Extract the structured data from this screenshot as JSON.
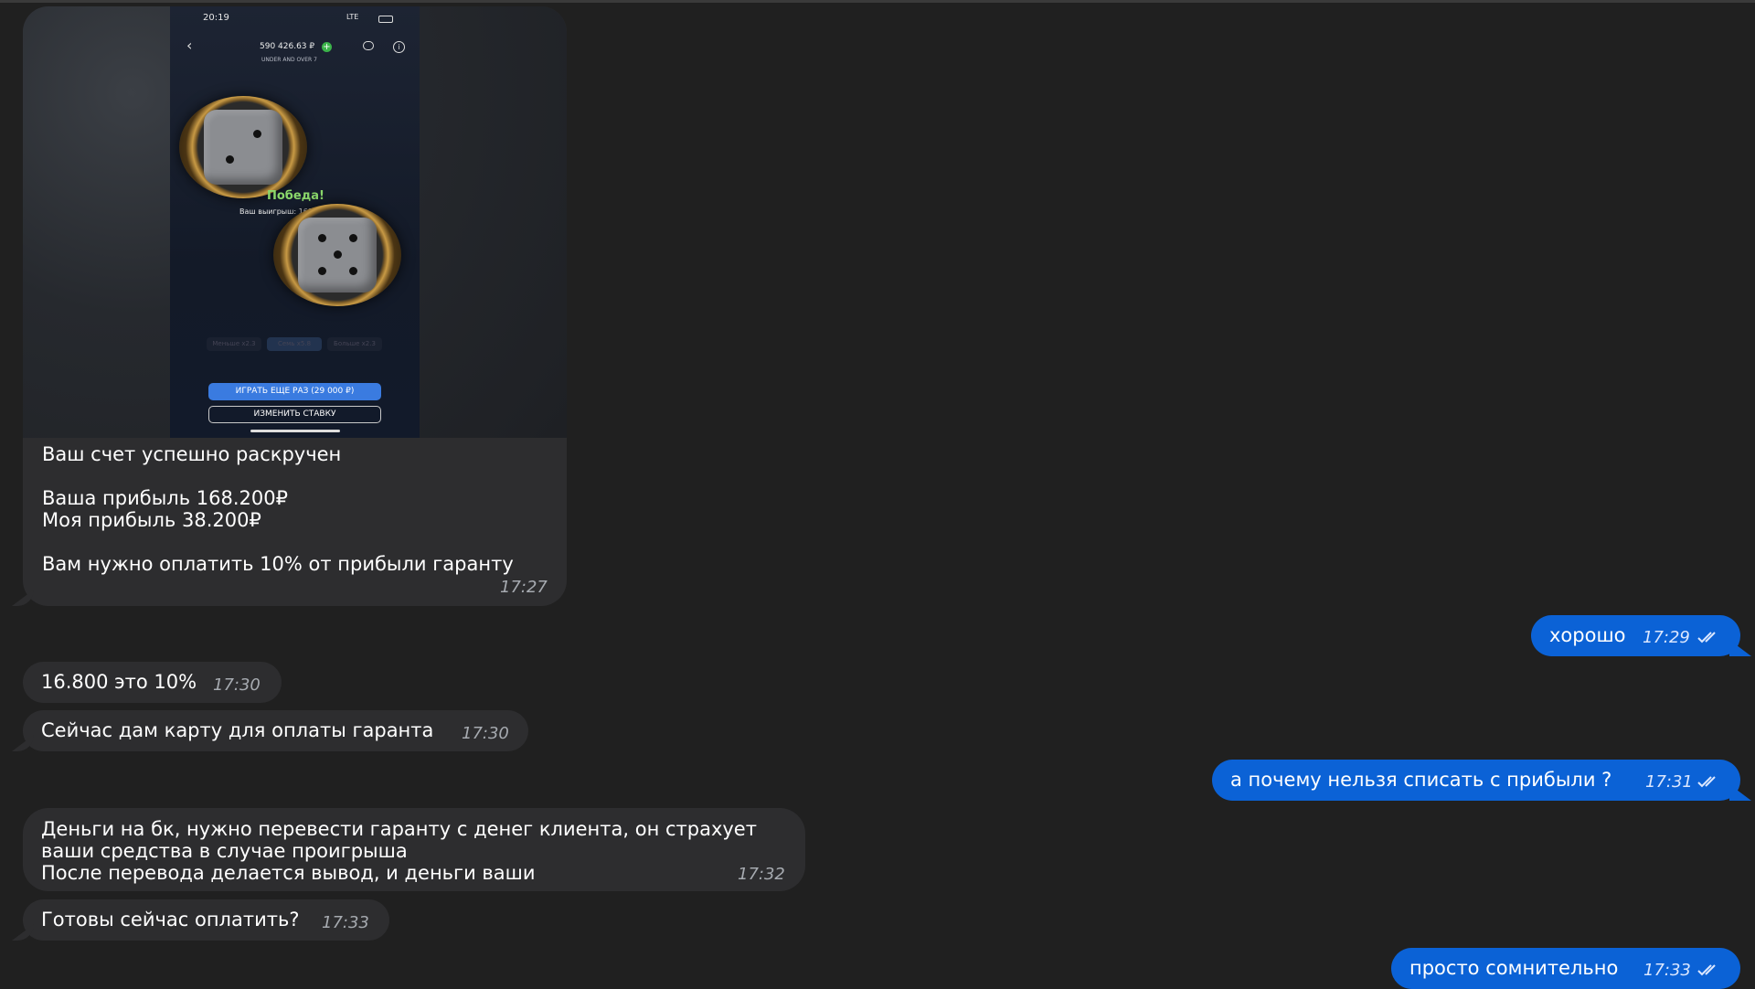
{
  "colors": {
    "background": "#202020",
    "incoming_bubble": "#2d2d2f",
    "outgoing_bubble": "#0b62d6",
    "win_text": "#8bd86b",
    "play_button": "#3a7be0"
  },
  "screenshot": {
    "clock": "20:19",
    "network": "LTE",
    "balance": "590 426.63 ₽",
    "game_name": "UNDER AND OVER 7",
    "win_title": "Победа!",
    "win_amount": "Ваш выигрыш: 168 200 ₽",
    "dice_values": [
      2,
      5
    ],
    "bet_options": [
      "Меньше x2.3",
      "Семь x5.8",
      "Больше x2.3"
    ],
    "play_again_label": "ИГРАТЬ ЕЩЕ РАЗ (29 000 ₽)",
    "change_bet_label": "ИЗМЕНИТЬ СТАВКУ",
    "icons": [
      "back-arrow-icon",
      "add-balance-icon",
      "chat-icon",
      "info-icon"
    ]
  },
  "messages": [
    {
      "direction": "in",
      "lines": [
        "Ваш счет успешно раскручен",
        "",
        "Ваша прибыль 168.200₽",
        "Моя прибыль 38.200₽",
        "",
        "Вам нужно оплатить 10% от прибыли гаранту"
      ],
      "time": "17:27",
      "has_media": true
    },
    {
      "direction": "out",
      "text": "хорошо",
      "time": "17:29",
      "read": true
    },
    {
      "direction": "in",
      "text": "16.800 это 10%",
      "time": "17:30"
    },
    {
      "direction": "in",
      "text": "Сейчас дам карту для оплаты гаранта",
      "time": "17:30"
    },
    {
      "direction": "out",
      "text": "а почему нельзя списать с прибыли ?",
      "time": "17:31",
      "read": true
    },
    {
      "direction": "in",
      "lines": [
        "Деньги на бк, нужно перевести гаранту с денег клиента, он страхует",
        "ваши средства в случае проигрыша",
        "После перевода делается вывод, и деньги ваши"
      ],
      "time": "17:32"
    },
    {
      "direction": "in",
      "text": "Готовы сейчас оплатить?",
      "time": "17:33"
    },
    {
      "direction": "out",
      "text": "просто сомнительно",
      "time": "17:33",
      "read": true
    }
  ]
}
